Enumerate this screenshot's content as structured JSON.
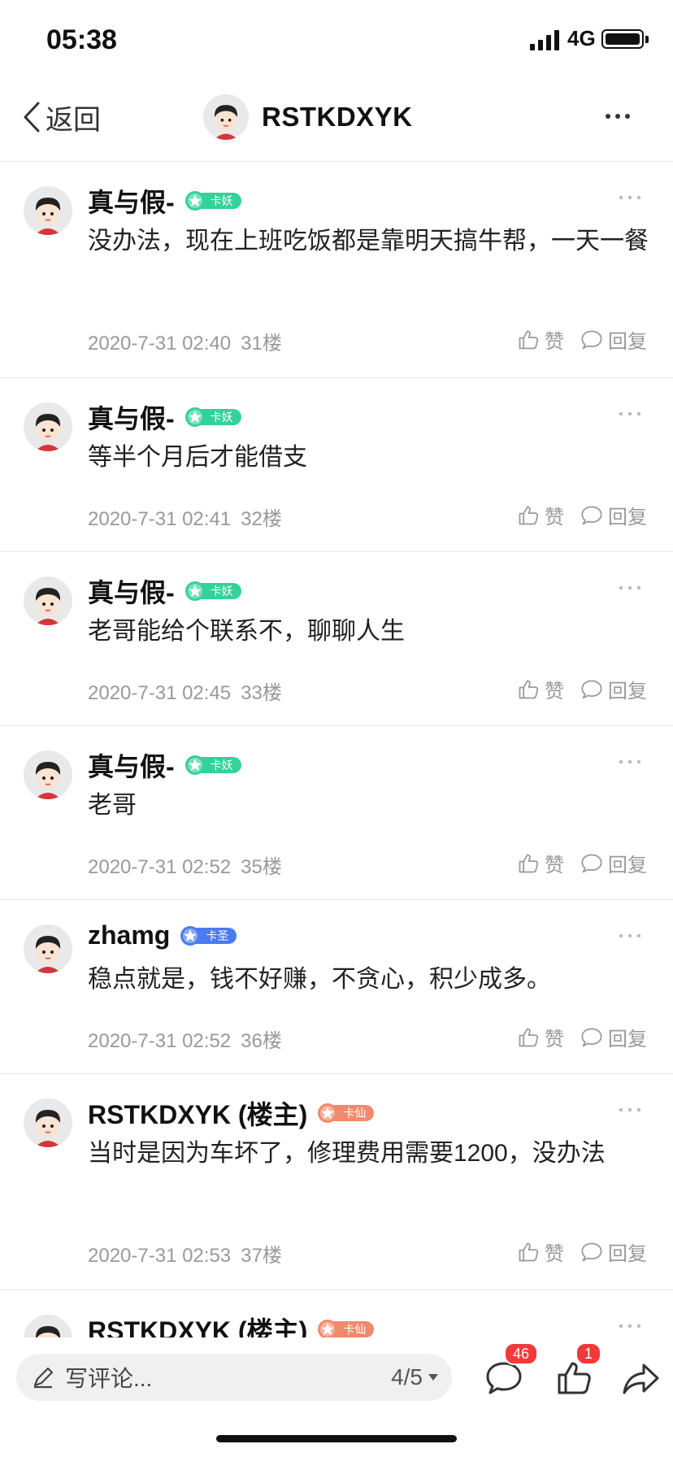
{
  "status": {
    "time": "05:38",
    "network": "4G"
  },
  "nav": {
    "back_label": "返回",
    "title": "RSTKDXYK"
  },
  "posts": [
    {
      "name": "真与假-",
      "badge": "卡妖",
      "badge_color": "#33d29a",
      "text": "没办法，现在上班吃饭都是靠明天搞牛帮，一天一餐",
      "date": "2020-7-31 02:40",
      "floor": "31楼",
      "like": "赞",
      "reply": "回复"
    },
    {
      "name": "真与假-",
      "badge": "卡妖",
      "badge_color": "#33d29a",
      "text": "等半个月后才能借支",
      "date": "2020-7-31 02:41",
      "floor": "32楼",
      "like": "赞",
      "reply": "回复"
    },
    {
      "name": "真与假-",
      "badge": "卡妖",
      "badge_color": "#33d29a",
      "text": "老哥能给个联系不，聊聊人生",
      "date": "2020-7-31 02:45",
      "floor": "33楼",
      "like": "赞",
      "reply": "回复"
    },
    {
      "name": "真与假-",
      "badge": "卡妖",
      "badge_color": "#33d29a",
      "text": "老哥",
      "date": "2020-7-31 02:52",
      "floor": "35楼",
      "like": "赞",
      "reply": "回复"
    },
    {
      "name": "zhamg",
      "badge": "卡圣",
      "badge_color": "#4a7bf0",
      "text": "稳点就是，钱不好赚，不贪心，积少成多。",
      "date": "2020-7-31 02:52",
      "floor": "36楼",
      "like": "赞",
      "reply": "回复"
    },
    {
      "name": "RSTKDXYK (楼主)",
      "badge": "卡仙",
      "badge_color": "#f08a6a",
      "text": "当时是因为车坏了，修理费用需要1200，没办法",
      "date": "2020-7-31 02:53",
      "floor": "37楼",
      "like": "赞",
      "reply": "回复"
    },
    {
      "name": "RSTKDXYK (楼主)",
      "badge": "卡仙",
      "badge_color": "#f08a6a",
      "text": "",
      "date": "",
      "floor": "",
      "like": "",
      "reply": ""
    }
  ],
  "bottom": {
    "placeholder": "写评论...",
    "page": "4/5",
    "comment_count": "46",
    "like_count": "1"
  }
}
